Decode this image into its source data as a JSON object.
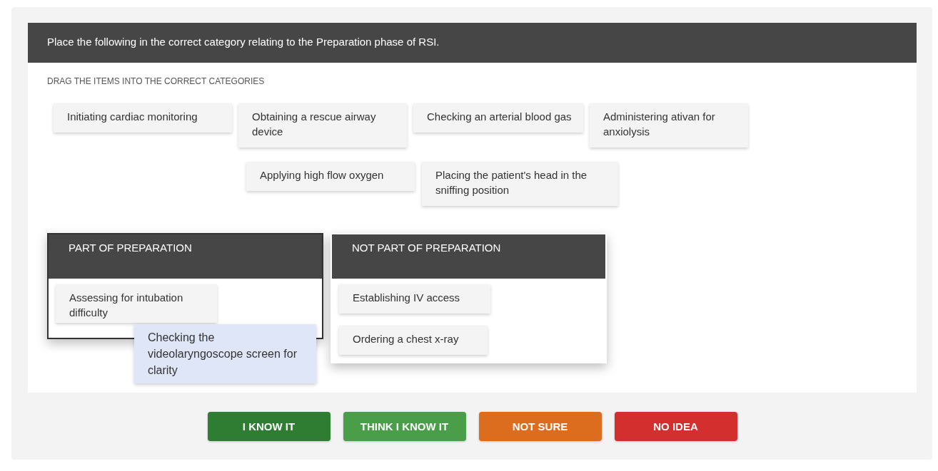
{
  "question": "Place the following in the correct category relating to the Preparation phase of RSI.",
  "instruction": "DRAG THE ITEMS INTO THE CORRECT CATEGORIES",
  "item_rows": [
    [
      "Initiating cardiac monitoring",
      "Obtaining a rescue airway device",
      "Checking an arterial blood gas",
      "Administering ativan for anxiolysis"
    ],
    [
      "Applying high flow oxygen",
      "Placing the patient's head in the sniffing position"
    ]
  ],
  "categories": [
    {
      "title": "PART OF PREPARATION",
      "highlighted": true,
      "items": [
        "Assessing for intubation difficulty"
      ]
    },
    {
      "title": "NOT PART OF PREPARATION",
      "highlighted": false,
      "items": [
        "Establishing IV access",
        "Ordering a chest x-ray"
      ]
    }
  ],
  "dragged_item": "Checking the videolaryngoscope screen for clarity",
  "buttons": [
    {
      "label": "I KNOW IT",
      "color": "#2e7d32"
    },
    {
      "label": "THINK I KNOW IT",
      "color": "#4a9e4a"
    },
    {
      "label": "NOT SURE",
      "color": "#dc6d1f"
    },
    {
      "label": "NO IDEA",
      "color": "#d32f2f"
    }
  ]
}
